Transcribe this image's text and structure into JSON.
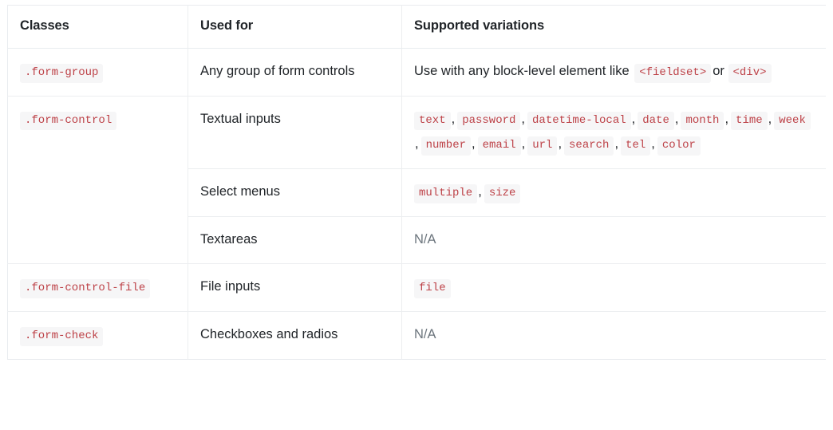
{
  "table": {
    "headers": {
      "classes": "Classes",
      "used_for": "Used for",
      "supported_variations": "Supported variations"
    },
    "rows": [
      {
        "class_name": ".form-group",
        "used_for": "Any group of form controls",
        "variations_lead": "Use with any block-level element like",
        "variations_codes": [
          "<fieldset>",
          "<div>"
        ],
        "variations_joiner": "or"
      },
      {
        "class_name": ".form-control",
        "used_for": "Textual inputs",
        "variations_codes": [
          "text",
          "password",
          "datetime-local",
          "date",
          "month",
          "time",
          "week",
          "number",
          "email",
          "url",
          "search",
          "tel",
          "color"
        ]
      },
      {
        "class_name": "",
        "used_for": "Select menus",
        "variations_codes": [
          "multiple",
          "size"
        ]
      },
      {
        "class_name": "",
        "used_for": "Textareas",
        "variations_na": "N/A"
      },
      {
        "class_name": ".form-control-file",
        "used_for": "File inputs",
        "variations_codes": [
          "file"
        ]
      },
      {
        "class_name": ".form-check",
        "used_for": "Checkboxes and radios",
        "variations_na": "N/A"
      }
    ]
  },
  "colors": {
    "code_text": "#bd4147",
    "code_bg": "#f6f6f7",
    "border": "#e9ecef",
    "text": "#212529",
    "muted": "#6c757d"
  }
}
